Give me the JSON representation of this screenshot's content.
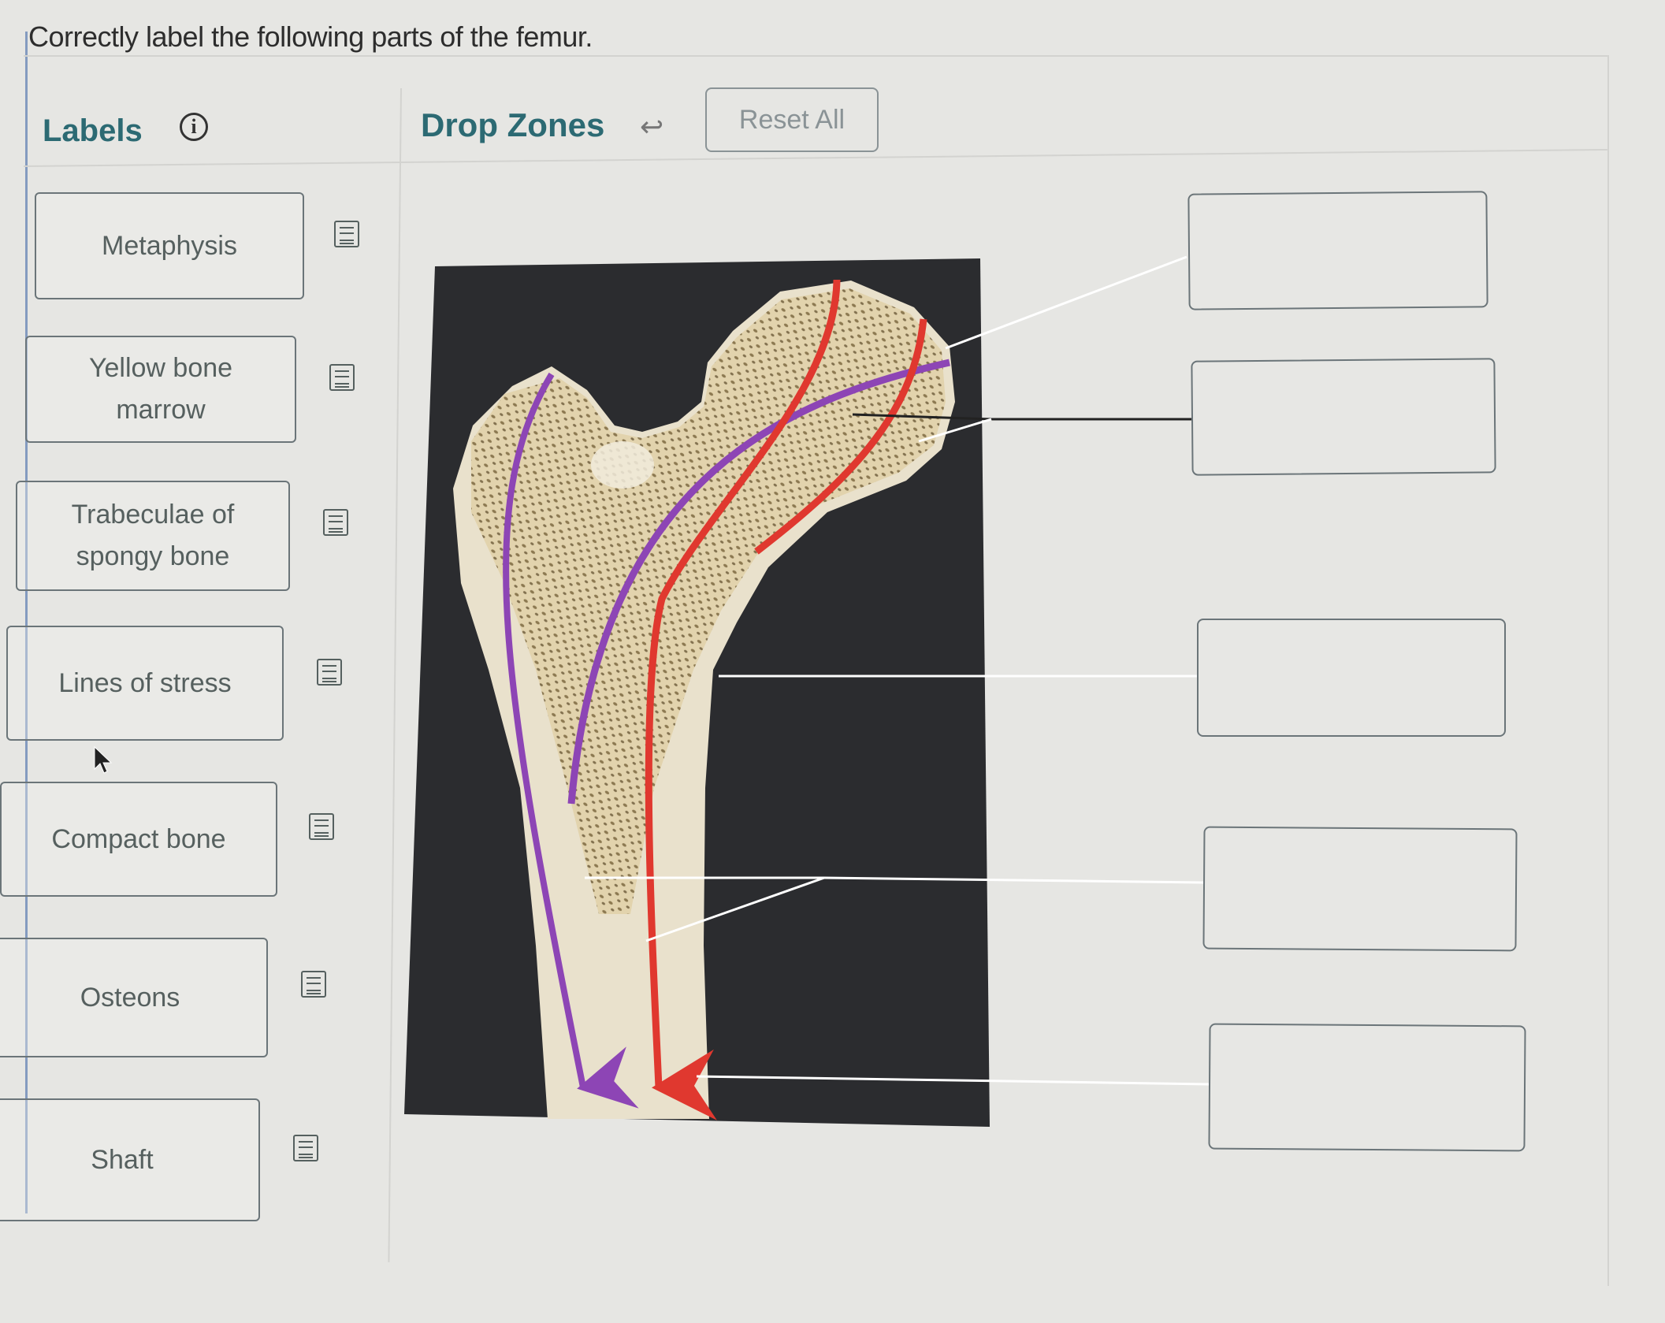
{
  "instructions": "Correctly label the following parts of the femur.",
  "labels_panel": {
    "title": "Labels",
    "info_icon": "info-circle-icon",
    "items": [
      {
        "text": "Metaphysis",
        "note_icon": "notepad-icon"
      },
      {
        "text": "Yellow bone marrow",
        "note_icon": "notepad-icon"
      },
      {
        "text": "Trabeculae of spongy bone",
        "note_icon": "notepad-icon"
      },
      {
        "text": "Lines of stress",
        "note_icon": "notepad-icon"
      },
      {
        "text": "Compact bone",
        "note_icon": "notepad-icon"
      },
      {
        "text": "Osteons",
        "note_icon": "notepad-icon"
      },
      {
        "text": "Shaft",
        "note_icon": "notepad-icon"
      }
    ]
  },
  "drop_zones_panel": {
    "title": "Drop Zones",
    "undo_icon": "undo-arrow-icon",
    "reset_label": "Reset All",
    "zones": [
      {
        "value": ""
      },
      {
        "value": ""
      },
      {
        "value": ""
      },
      {
        "value": ""
      },
      {
        "value": ""
      }
    ]
  },
  "figure": {
    "subject": "Longitudinal section of proximal femur with lines of stress",
    "colors": {
      "compression_lines": "#e0382f",
      "tension_lines": "#8d45b5",
      "background": "#2b2c2f",
      "bone": "#e9e1cc"
    }
  },
  "colors": {
    "accent": "#2c6a73",
    "border": "#6b7579",
    "page_bg": "#e6e6e3"
  }
}
